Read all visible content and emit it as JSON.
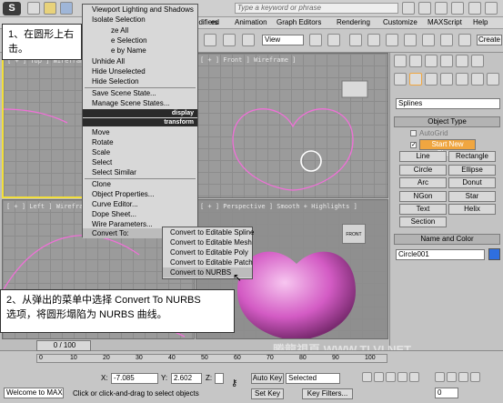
{
  "title_bar": {
    "search_placeholder": "Type a keyword or phrase"
  },
  "menubar": {
    "items": [
      "ed",
      "odifiers",
      "Animation",
      "Graph Editors",
      "Rendering",
      "Customize",
      "MAXScript",
      "Help"
    ]
  },
  "toolbar": {
    "view_select": "View",
    "create_label": "Create"
  },
  "viewports": {
    "top": "[ + ] Top ] Wireframe ]",
    "front": "[ + ] Front ] Wireframe ]",
    "left": "[ + ] Left ] Wirefram",
    "perspective": "[ + ] Perspective ] Smooth + Highlights ]",
    "viewcube_front": "FRONT"
  },
  "quad_menu": {
    "viewport_lighting": "Viewport Lighting and Shadows",
    "isolate": "Isolate Selection",
    "unfreeze_all": "ze All",
    "hide_selection_partial": "e Selection",
    "unhide_by_name": "e by Name",
    "unhide_all": "Unhide All",
    "hide_unselected": "Hide Unselected",
    "hide_selection": "Hide Selection",
    "save_scene_state": "Save Scene State...",
    "manage_scene_states": "Manage Scene States...",
    "display_header": "display",
    "transform_header": "transform",
    "move": "Move",
    "rotate": "Rotate",
    "scale": "Scale",
    "select": "Select",
    "select_similar": "Select Similar",
    "clone": "Clone",
    "object_properties": "Object Properties...",
    "curve_editor": "Curve Editor...",
    "dope_sheet": "Dope Sheet...",
    "wire_parameters": "Wire Parameters...",
    "convert_to": "Convert To:"
  },
  "submenu": {
    "items": [
      "Convert to Editable Spline",
      "Convert to Editable Mesh",
      "Convert to Editable Poly",
      "Convert to Editable Patch",
      "Convert to NURBS"
    ]
  },
  "annotations": {
    "step1": "1、在圆形上右击。",
    "step2_line1": "2、从弹出的菜单中选择 Convert To NURBS",
    "step2_line2": "选项，将圆形塌陷为 NURBS 曲线。"
  },
  "command_panel": {
    "category": "Splines",
    "object_type_header": "Object Type",
    "autogrid": "AutoGrid",
    "start_new_shape": "Start New Shape",
    "buttons": [
      "Line",
      "Rectangle",
      "Circle",
      "Ellipse",
      "Arc",
      "Donut",
      "NGon",
      "Star",
      "Text",
      "Helix",
      "Section"
    ],
    "name_color_header": "Name and Color",
    "object_name": "Circle001",
    "color_swatch": "#2f6fe0"
  },
  "timeline": {
    "frame_display": "0 / 100",
    "ticks": [
      "0",
      "10",
      "20",
      "30",
      "40",
      "50",
      "60",
      "70",
      "80",
      "90",
      "100"
    ]
  },
  "status": {
    "welcome": "Welcome to MAX",
    "prompt": "Click or click-and-drag to select objects",
    "x_label": "X:",
    "x_value": "-7.085",
    "y_label": "Y:",
    "y_value": "2.602",
    "z_label": "Z:",
    "auto_key": "Auto Key",
    "set_key": "Set Key",
    "selected_dropdown": "Selected",
    "key_filters": "Key Filters...",
    "frame_value": "0"
  },
  "watermark": "腾龍視頁 WWW.TLVI.NET",
  "colors": {
    "active_border": "#f2df3a",
    "shape_pink": "#f070d8",
    "highlight_orange": "#f0a640",
    "menu_header": "#2a2a2a"
  }
}
